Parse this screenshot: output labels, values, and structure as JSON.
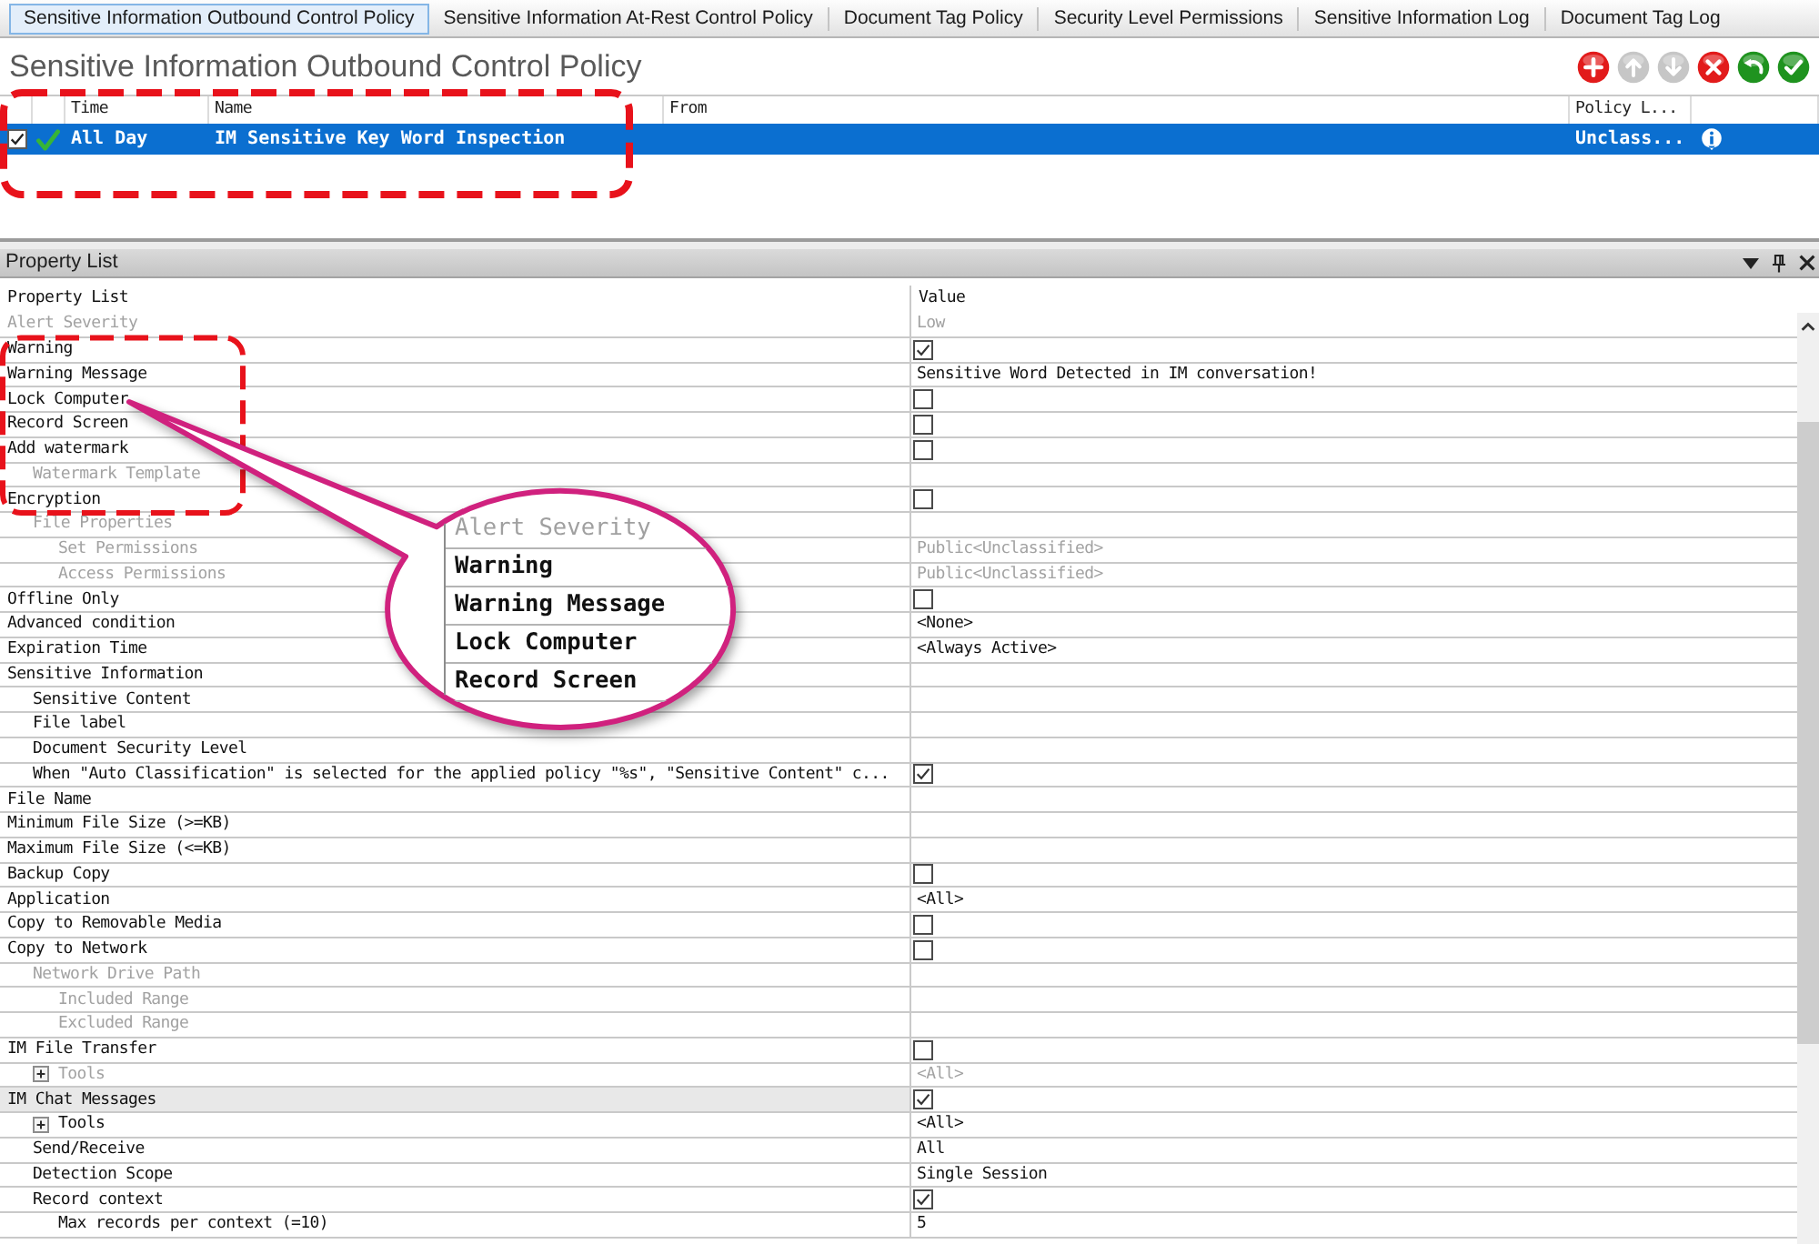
{
  "tabs": [
    {
      "label": "Sensitive Information Outbound Control Policy",
      "selected": true
    },
    {
      "label": "Sensitive Information At-Rest Control Policy",
      "selected": false
    },
    {
      "label": "Document Tag Policy",
      "selected": false
    },
    {
      "label": "Security Level Permissions",
      "selected": false
    },
    {
      "label": "Sensitive Information Log",
      "selected": false
    },
    {
      "label": "Document Tag Log",
      "selected": false
    }
  ],
  "page_title": "Sensitive Information Outbound Control Policy",
  "toolbar": [
    {
      "kind": "add",
      "disabled": false
    },
    {
      "kind": "move_up",
      "disabled": true
    },
    {
      "kind": "move_down",
      "disabled": true
    },
    {
      "kind": "delete",
      "disabled": false
    },
    {
      "kind": "undo",
      "disabled": false
    },
    {
      "kind": "apply",
      "disabled": false
    }
  ],
  "policy_table": {
    "columns": [
      "Time",
      "Name",
      "From",
      "Policy L..."
    ],
    "rows": [
      {
        "checked": true,
        "selected": true,
        "time": "All Day",
        "name": "IM Sensitive Key Word Inspection",
        "policy_level": "Unclass..."
      }
    ]
  },
  "property_panel": {
    "title": "Property List",
    "columns": [
      "Property List",
      "Value"
    ],
    "rows": [
      {
        "label": "Alert Severity",
        "disabled": true,
        "selected": false,
        "value": {
          "kind": "text",
          "text": "Low"
        }
      },
      {
        "label": "Warning",
        "disabled": false,
        "selected": false,
        "value": {
          "kind": "checkbox",
          "checked": true
        }
      },
      {
        "label": "Warning Message",
        "disabled": false,
        "selected": false,
        "value": {
          "kind": "text",
          "text": "Sensitive Word Detected in IM conversation!"
        }
      },
      {
        "label": "Lock Computer",
        "disabled": false,
        "selected": false,
        "value": {
          "kind": "checkbox",
          "checked": false
        }
      },
      {
        "label": "Record Screen",
        "disabled": false,
        "selected": false,
        "value": {
          "kind": "checkbox",
          "checked": false
        }
      },
      {
        "label": "Add watermark",
        "disabled": false,
        "selected": false,
        "value": {
          "kind": "checkbox",
          "checked": false
        },
        "children": [
          {
            "label": "Watermark Template",
            "disabled": true,
            "selected": false
          }
        ]
      },
      {
        "label": "Encryption",
        "disabled": false,
        "selected": false,
        "value": {
          "kind": "checkbox",
          "checked": false
        },
        "children": [
          {
            "label": "File Properties",
            "disabled": true,
            "selected": false,
            "children": [
              {
                "label": "Set Permissions",
                "disabled": true,
                "selected": false,
                "value": {
                  "kind": "text",
                  "text": "Public<Unclassified>"
                }
              },
              {
                "label": "Access Permissions",
                "disabled": true,
                "selected": false,
                "value": {
                  "kind": "text",
                  "text": "Public<Unclassified>"
                }
              }
            ]
          }
        ]
      },
      {
        "label": "Offline Only",
        "disabled": false,
        "selected": false,
        "value": {
          "kind": "checkbox",
          "checked": false
        }
      },
      {
        "label": "Advanced condition",
        "disabled": false,
        "selected": false,
        "value": {
          "kind": "text",
          "text": "<None>"
        }
      },
      {
        "label": "Expiration Time",
        "disabled": false,
        "selected": false,
        "value": {
          "kind": "text",
          "text": "<Always Active>"
        }
      },
      {
        "label": "Sensitive Information",
        "disabled": false,
        "selected": false,
        "children": [
          {
            "label": "Sensitive Content",
            "disabled": false,
            "selected": false
          },
          {
            "label": "File label",
            "disabled": false,
            "selected": false
          },
          {
            "label": "Document Security Level",
            "disabled": false,
            "selected": false
          },
          {
            "label": "When \"Auto Classification\" is selected for the applied policy \"%s\", \"Sensitive Content\" c...",
            "disabled": false,
            "selected": false,
            "value": {
              "kind": "checkbox",
              "checked": true
            }
          }
        ]
      },
      {
        "label": "File Name",
        "disabled": false,
        "selected": false
      },
      {
        "label": "Minimum File Size (>=KB)",
        "disabled": false,
        "selected": false
      },
      {
        "label": "Maximum File Size (<=KB)",
        "disabled": false,
        "selected": false
      },
      {
        "label": "Backup Copy",
        "disabled": false,
        "selected": false,
        "value": {
          "kind": "checkbox",
          "checked": false
        }
      },
      {
        "label": "Application",
        "disabled": false,
        "selected": false,
        "value": {
          "kind": "text",
          "text": "<All>"
        }
      },
      {
        "label": "Copy to Removable Media",
        "disabled": false,
        "selected": false,
        "value": {
          "kind": "checkbox",
          "checked": false
        }
      },
      {
        "label": "Copy to Network",
        "disabled": false,
        "selected": false,
        "value": {
          "kind": "checkbox",
          "checked": false
        },
        "children": [
          {
            "label": "Network Drive Path",
            "disabled": true,
            "selected": false,
            "children": [
              {
                "label": "Included Range",
                "disabled": true,
                "selected": false
              },
              {
                "label": "Excluded Range",
                "disabled": true,
                "selected": false
              }
            ]
          }
        ]
      },
      {
        "label": "IM File Transfer",
        "disabled": false,
        "selected": false,
        "value": {
          "kind": "checkbox",
          "checked": false
        },
        "children": [
          {
            "label": "Tools",
            "disabled": true,
            "selected": false,
            "expanded": false,
            "value": {
              "kind": "text",
              "text": "<All>"
            }
          }
        ]
      },
      {
        "label": "IM Chat Messages",
        "disabled": false,
        "selected": true,
        "value": {
          "kind": "checkbox",
          "checked": true
        },
        "children": [
          {
            "label": "Tools",
            "disabled": false,
            "selected": false,
            "expanded": false,
            "value": {
              "kind": "text",
              "text": "<All>"
            }
          },
          {
            "label": "Send/Receive",
            "disabled": false,
            "selected": false,
            "value": {
              "kind": "text",
              "text": "All"
            }
          },
          {
            "label": "Detection Scope",
            "disabled": false,
            "selected": false,
            "value": {
              "kind": "text",
              "text": "Single Session"
            }
          },
          {
            "label": "Record context",
            "disabled": false,
            "selected": false,
            "value": {
              "kind": "checkbox",
              "checked": true
            },
            "children": [
              {
                "label": "Max records per context (=10)",
                "disabled": false,
                "selected": false,
                "value": {
                  "kind": "text",
                  "text": "5"
                }
              }
            ]
          }
        ]
      }
    ]
  },
  "callout": {
    "lines": [
      {
        "text": "Alert Severity",
        "disabled": true
      },
      {
        "text": "Warning",
        "disabled": false
      },
      {
        "text": "Warning Message",
        "disabled": false
      },
      {
        "text": "Lock Computer",
        "disabled": false
      },
      {
        "text": "Record Screen",
        "disabled": false
      }
    ]
  }
}
